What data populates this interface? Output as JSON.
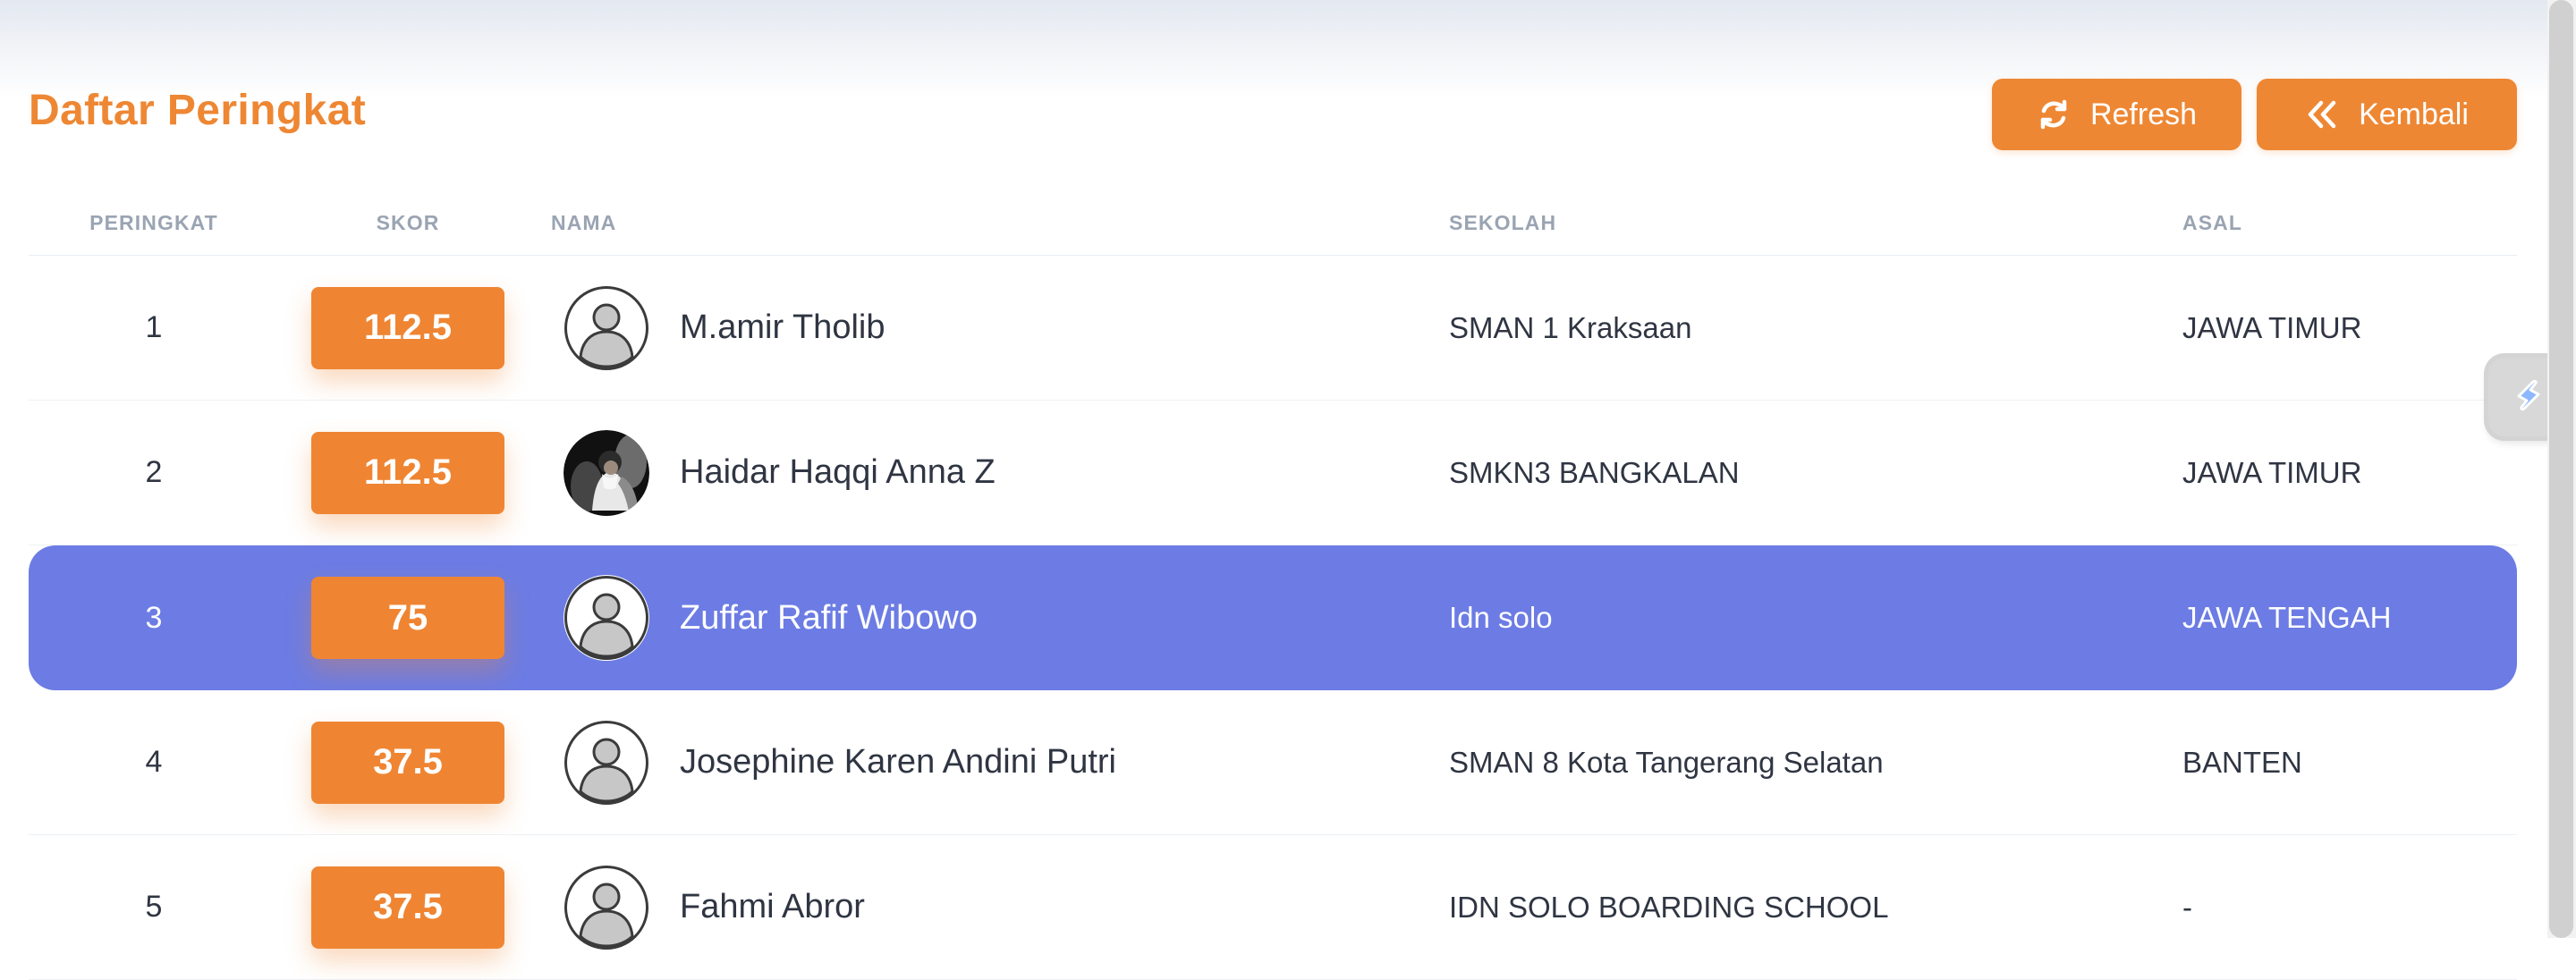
{
  "header": {
    "title": "Daftar Peringkat",
    "refresh_label": "Refresh",
    "back_label": "Kembali",
    "refresh_icon": "refresh-icon",
    "back_icon": "double-chevron-left-icon"
  },
  "table": {
    "columns": {
      "rank": "PERINGKAT",
      "score": "SKOR",
      "name": "NAMA",
      "school": "SEKOLAH",
      "origin": "ASAL"
    },
    "rows": [
      {
        "rank": "1",
        "score": "112.5",
        "name": "M.amir Tholib",
        "school": "SMAN 1 Kraksaan",
        "origin": "JAWA TIMUR",
        "avatar": "default-avatar-icon",
        "highlighted": false
      },
      {
        "rank": "2",
        "score": "112.5",
        "name": "Haidar Haqqi Anna Z",
        "school": "SMKN3 BANGKALAN",
        "origin": "JAWA TIMUR",
        "avatar": "profile-photo",
        "highlighted": false
      },
      {
        "rank": "3",
        "score": "75",
        "name": "Zuffar Rafif Wibowo",
        "school": "Idn solo",
        "origin": "JAWA TENGAH",
        "avatar": "default-avatar-icon",
        "highlighted": true
      },
      {
        "rank": "4",
        "score": "37.5",
        "name": "Josephine Karen Andini Putri",
        "school": "SMAN 8 Kota Tangerang Selatan",
        "origin": "BANTEN",
        "avatar": "default-avatar-icon",
        "highlighted": false
      },
      {
        "rank": "5",
        "score": "37.5",
        "name": "Fahmi Abror",
        "school": "IDN SOLO BOARDING SCHOOL",
        "origin": "-",
        "avatar": "default-avatar-icon",
        "highlighted": false
      }
    ]
  },
  "colors": {
    "accent": "#ee8733",
    "highlight": "#6c7ce4",
    "header_text": "#9aa4b2",
    "body_text": "#2f3542"
  },
  "floating_helper": {
    "icon": "lightning-shortcut-icon"
  }
}
